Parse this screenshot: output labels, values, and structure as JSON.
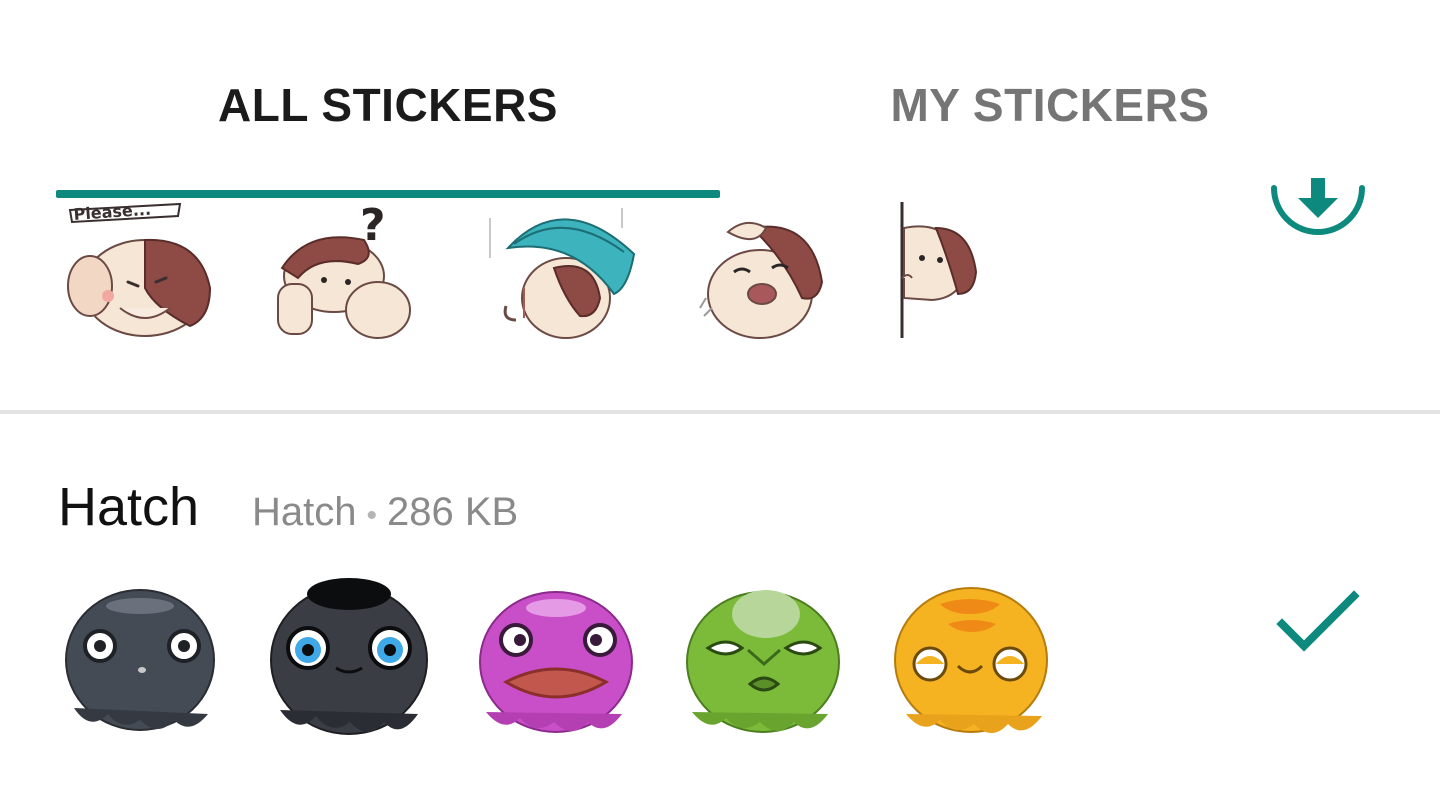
{
  "tabs": {
    "all_label": "ALL STICKERS",
    "mine_label": "MY STICKERS",
    "active": "ALL STICKERS"
  },
  "packs": [
    {
      "stickers": [
        "dog-please-sticker",
        "dog-confused-sticker",
        "dog-umbrella-sticker",
        "dog-crying-sticker",
        "dog-peeking-sticker"
      ],
      "action_icon": "download-icon"
    },
    {
      "title": "Hatch",
      "author": "Hatch",
      "separator": "•",
      "size": "286 KB",
      "stickers": [
        "hatch-dark-gray-sticker",
        "hatch-black-sticker",
        "hatch-purple-sticker",
        "hatch-green-sticker",
        "hatch-yellow-sticker"
      ],
      "action_icon": "check-icon"
    }
  ],
  "colors": {
    "accent": "#0d8a7d",
    "active_tab_text": "#1b1b1b",
    "inactive_tab_text": "#757575",
    "divider": "#e3e3e3"
  }
}
